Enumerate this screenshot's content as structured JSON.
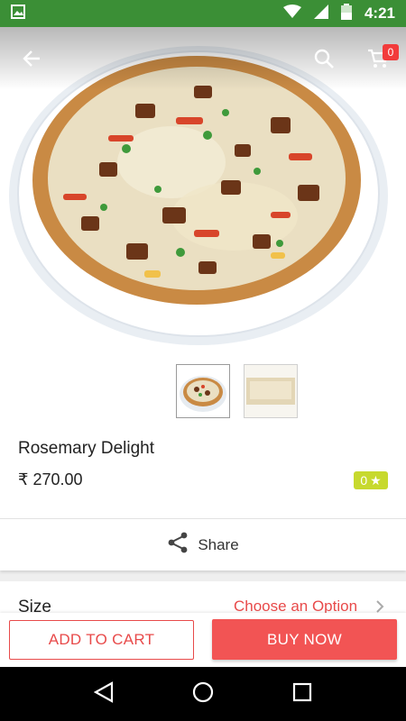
{
  "status_bar": {
    "time": "4:21",
    "icons": [
      "image-notification-icon",
      "wifi-icon",
      "signal-icon",
      "battery-icon"
    ]
  },
  "toolbar": {
    "icons": [
      "back-arrow-icon",
      "search-icon",
      "cart-icon"
    ],
    "cart_count": "0"
  },
  "gallery": {
    "thumbnails": [
      "pizza-photo",
      "pizza-closeup-photo"
    ]
  },
  "product": {
    "name": "Rosemary Delight",
    "price": "₹ 270.00",
    "rating": "0"
  },
  "share": {
    "label": "Share"
  },
  "options": {
    "size_label": "Size",
    "size_value": "Choose an Option"
  },
  "actions": {
    "add_to_cart": "ADD TO CART",
    "buy_now": "BUY NOW"
  },
  "colors": {
    "status_bar": "#3b8f36",
    "accent": "#e84a4a",
    "buy_button": "#f25454",
    "rating_badge": "#c7d92e"
  }
}
